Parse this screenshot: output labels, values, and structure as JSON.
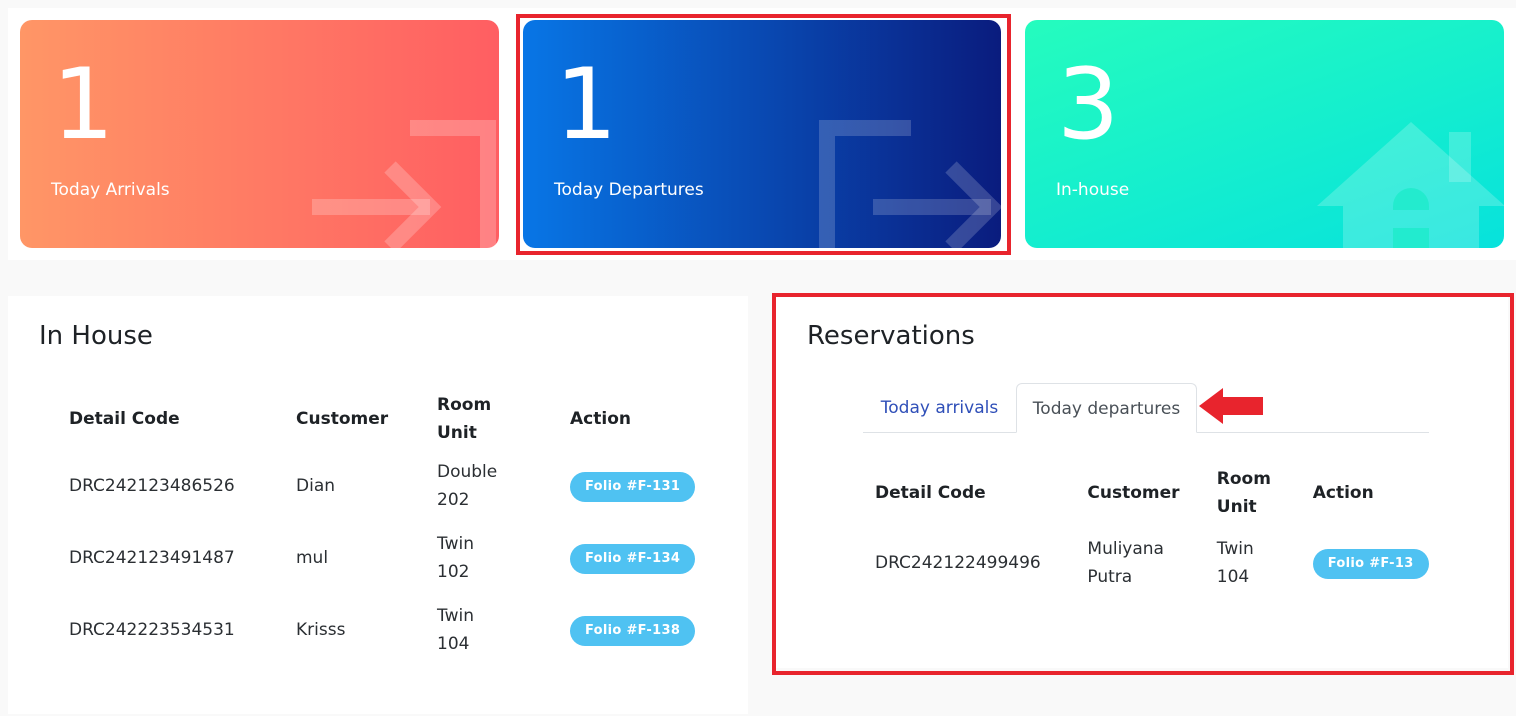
{
  "stats": {
    "arrivals": {
      "count": "1",
      "label": "Today Arrivals",
      "icon": "sign-in-icon",
      "gradient": [
        "#ff9666",
        "#ff5e62"
      ]
    },
    "departures": {
      "count": "1",
      "label": "Today Departures",
      "icon": "sign-out-icon",
      "gradient": [
        "#0876e6",
        "#0a1c7e"
      ]
    },
    "inhouse": {
      "count": "3",
      "label": "In-house",
      "icon": "house-icon",
      "gradient": [
        "#25fcbe",
        "#07e2dc"
      ]
    }
  },
  "inhouse_table": {
    "title": "In House",
    "headers": {
      "code": "Detail Code",
      "customer": "Customer",
      "room_line1": "Room",
      "room_line2": "Unit",
      "action": "Action"
    },
    "rows": [
      {
        "code": "DRC242123486526",
        "customer": "Dian",
        "room_type": "Double",
        "room_no": "202",
        "folio": "Folio #F-131"
      },
      {
        "code": "DRC242123491487",
        "customer": "mul",
        "room_type": "Twin",
        "room_no": "102",
        "folio": "Folio #F-134"
      },
      {
        "code": "DRC242223534531",
        "customer": "Krisss",
        "room_type": "Twin",
        "room_no": "104",
        "folio": "Folio #F-138"
      }
    ]
  },
  "reservations": {
    "title": "Reservations",
    "tabs": [
      {
        "label": "Today arrivals",
        "active": false
      },
      {
        "label": "Today departures",
        "active": true
      }
    ],
    "headers": {
      "code": "Detail Code",
      "customer": "Customer",
      "room_line1": "Room",
      "room_line2": "Unit",
      "action": "Action"
    },
    "rows": [
      {
        "code": "DRC242122499496",
        "customer_first": "Muliyana",
        "customer_last": "Putra",
        "room_type": "Twin",
        "room_no": "104",
        "folio": "Folio #F-13"
      }
    ]
  },
  "colors": {
    "highlight": "#e8242d",
    "badge": "#4fc2f2",
    "tab_link": "#2f4fb8"
  }
}
